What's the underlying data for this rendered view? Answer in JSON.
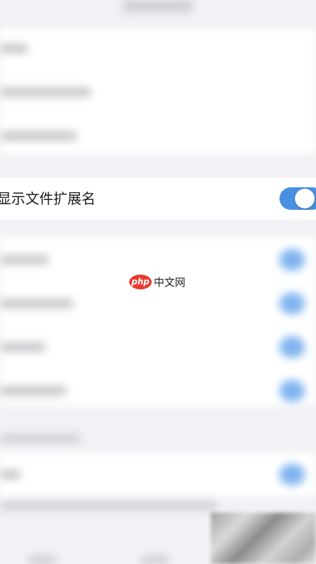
{
  "settings": {
    "focused_row": {
      "label": "显示文件扩展名",
      "toggle_on": true
    },
    "watermark": {
      "badge": "php",
      "text": "中文网"
    },
    "colors": {
      "toggle_on": "#4a90e2",
      "watermark_red": "#e8392f"
    }
  }
}
